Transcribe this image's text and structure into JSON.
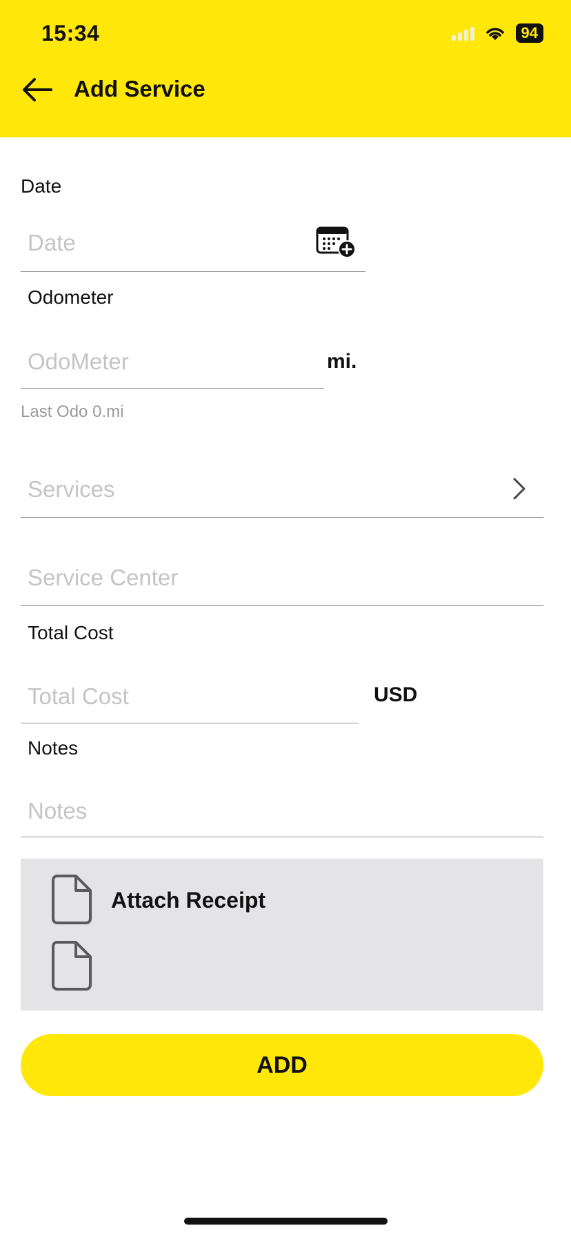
{
  "status": {
    "time": "15:34",
    "battery": "94"
  },
  "header": {
    "title": "Add Service"
  },
  "form": {
    "date_label": "Date",
    "date_placeholder": "Date",
    "odometer_label": "Odometer",
    "odometer_placeholder": "OdoMeter",
    "odometer_unit": "mi.",
    "last_odo_hint": "Last Odo 0.mi",
    "services_placeholder": "Services",
    "service_center_placeholder": "Service Center",
    "total_cost_label": "Total Cost",
    "total_cost_placeholder": "Total Cost",
    "currency": "USD",
    "notes_label": "Notes",
    "notes_placeholder": "Notes"
  },
  "attach": {
    "label": "Attach Receipt"
  },
  "actions": {
    "add_label": "ADD"
  },
  "colors": {
    "accent": "#FFE70A",
    "attach_bg": "#E4E4E7",
    "placeholder": "#C4C4C8"
  },
  "icons": [
    "back-arrow-icon",
    "calendar-add-icon",
    "chevron-right-icon",
    "document-icon",
    "wifi-icon",
    "signal-icon",
    "battery-icon"
  ]
}
